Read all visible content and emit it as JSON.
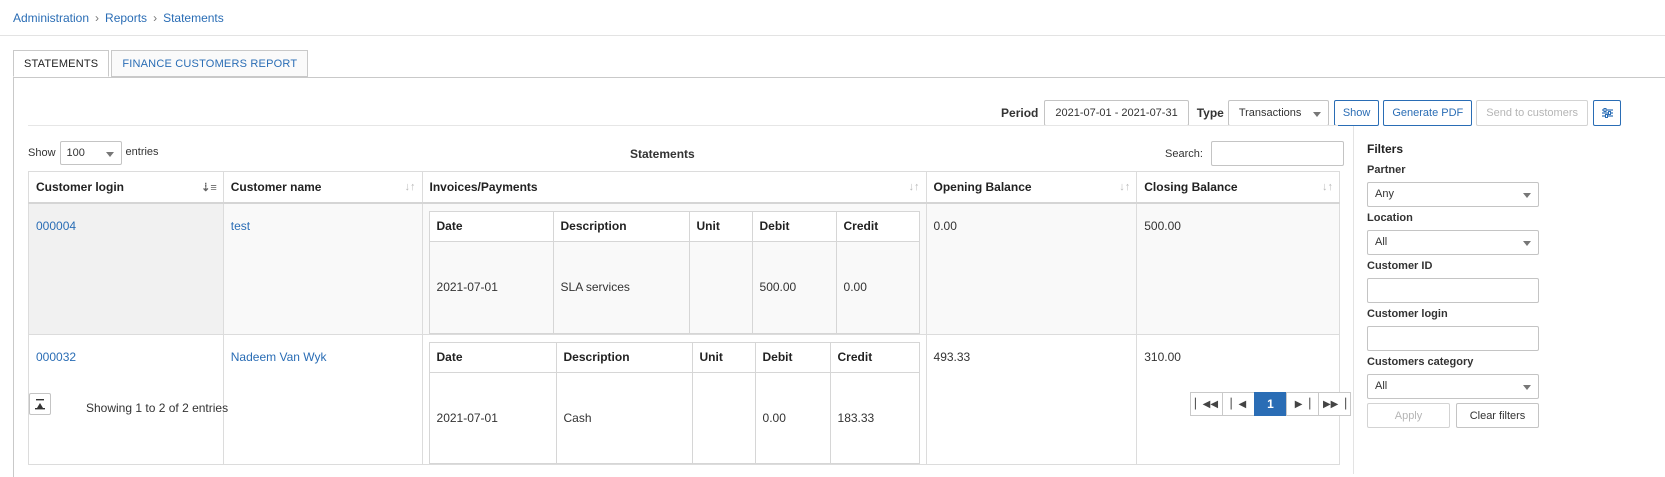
{
  "breadcrumb": [
    "Administration",
    "Reports",
    "Statements"
  ],
  "tabs": [
    {
      "label": "STATEMENTS",
      "active": true
    },
    {
      "label": "FINANCE CUSTOMERS REPORT",
      "active": false
    }
  ],
  "toolbar": {
    "period_label": "Period",
    "period_value": "2021-07-01 - 2021-07-31",
    "type_label": "Type",
    "type_value": "Transactions",
    "show_button": "Show",
    "generate_pdf_button": "Generate PDF",
    "send_button": "Send to customers",
    "settings_icon": "sliders-icon"
  },
  "table_controls": {
    "show_label": "Show",
    "entries_value": "100",
    "entries_label": "entries",
    "title": "Statements",
    "search_label": "Search:"
  },
  "columns": [
    "Customer login",
    "Customer name",
    "Invoices/Payments",
    "Opening Balance",
    "Closing Balance"
  ],
  "sub_columns": [
    "Date",
    "Description",
    "Unit",
    "Debit",
    "Credit"
  ],
  "rows": [
    {
      "login": "000004",
      "name": "test",
      "transactions": [
        {
          "date": "2021-07-01",
          "description": "SLA services",
          "unit": "",
          "debit": "500.00",
          "credit": "0.00"
        }
      ],
      "opening": "0.00",
      "closing": "500.00"
    },
    {
      "login": "000032",
      "name": "Nadeem Van Wyk",
      "transactions": [
        {
          "date": "2021-07-01",
          "description": "Cash",
          "unit": "",
          "debit": "0.00",
          "credit": "183.33"
        }
      ],
      "opening": "493.33",
      "closing": "310.00"
    }
  ],
  "footer": {
    "showing": "Showing 1 to 2 of 2 entries",
    "current_page": "1"
  },
  "filters": {
    "title": "Filters",
    "partner_label": "Partner",
    "partner_value": "Any",
    "location_label": "Location",
    "location_value": "All",
    "customer_id_label": "Customer ID",
    "customer_login_label": "Customer login",
    "category_label": "Customers category",
    "category_value": "All",
    "apply_button": "Apply",
    "clear_button": "Clear filters"
  },
  "colors": {
    "accent": "#2a6db5",
    "border": "#c9c9c9"
  }
}
